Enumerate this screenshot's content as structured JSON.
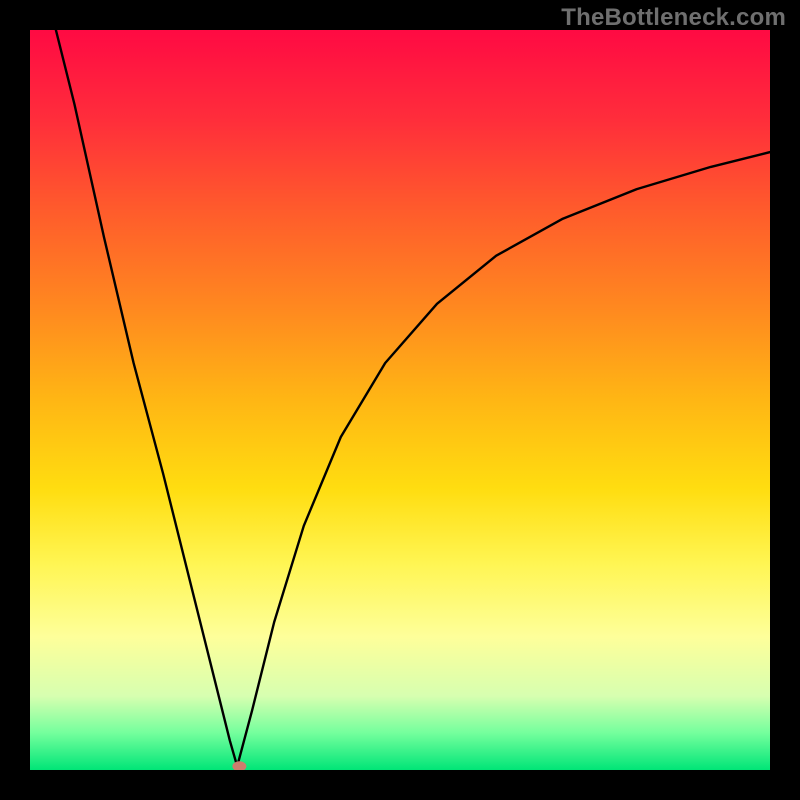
{
  "watermark": "TheBottleneck.com",
  "chart_data": {
    "type": "line",
    "title": "",
    "xlabel": "",
    "ylabel": "",
    "xlim": [
      0,
      100
    ],
    "ylim": [
      0,
      100
    ],
    "grid": false,
    "legend": false,
    "series": [
      {
        "name": "left-branch",
        "description": "steep descending segment from top-left toward vertex",
        "points": [
          {
            "x": 3.5,
            "y": 100
          },
          {
            "x": 6,
            "y": 90
          },
          {
            "x": 10,
            "y": 72
          },
          {
            "x": 14,
            "y": 55
          },
          {
            "x": 18,
            "y": 40
          },
          {
            "x": 22,
            "y": 24
          },
          {
            "x": 25,
            "y": 12
          },
          {
            "x": 27,
            "y": 4
          },
          {
            "x": 28,
            "y": 0.5
          }
        ]
      },
      {
        "name": "right-branch",
        "description": "ascending curved segment from vertex toward top-right",
        "points": [
          {
            "x": 28,
            "y": 0.5
          },
          {
            "x": 30,
            "y": 8
          },
          {
            "x": 33,
            "y": 20
          },
          {
            "x": 37,
            "y": 33
          },
          {
            "x": 42,
            "y": 45
          },
          {
            "x": 48,
            "y": 55
          },
          {
            "x": 55,
            "y": 63
          },
          {
            "x": 63,
            "y": 69.5
          },
          {
            "x": 72,
            "y": 74.5
          },
          {
            "x": 82,
            "y": 78.5
          },
          {
            "x": 92,
            "y": 81.5
          },
          {
            "x": 100,
            "y": 83.5
          }
        ]
      }
    ],
    "vertex": {
      "x": 28.3,
      "y": 0.5
    },
    "vertex_marker_color": "#cc7d6d"
  },
  "colors": {
    "frame": "#000000",
    "watermark": "#6f6f6f",
    "curve": "#000000",
    "gradient_top": "#ff0a43",
    "gradient_mid": "#ffdd10",
    "gradient_bottom": "#00e577"
  }
}
